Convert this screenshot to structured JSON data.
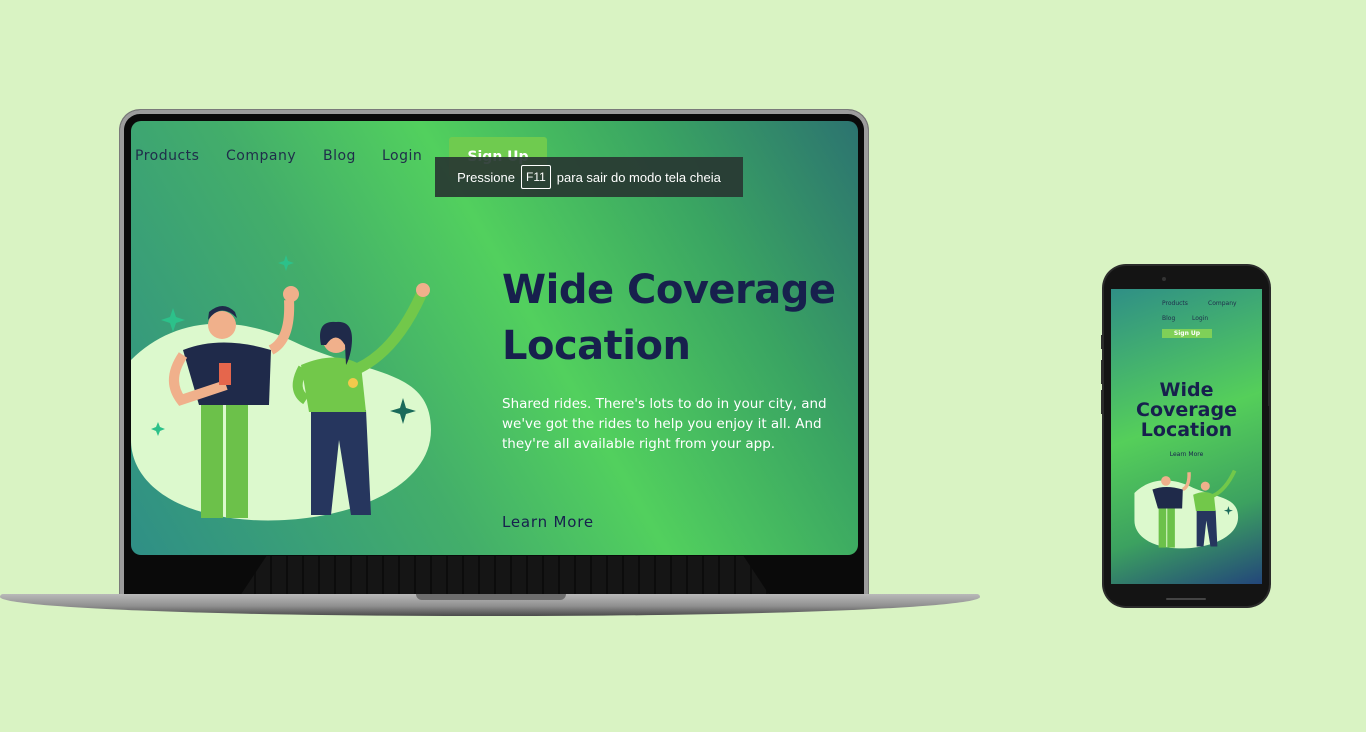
{
  "laptop": {
    "nav": {
      "products": "Products",
      "company": "Company",
      "blog": "Blog",
      "login": "Login",
      "signup": "Sign Up"
    },
    "toast": {
      "prefix": "Pressione",
      "key": "F11",
      "suffix": "para sair do modo tela cheia"
    },
    "hero": {
      "title_line1": "Wide Coverage",
      "title_line2": "Location",
      "text": "Shared rides. There's lots to do in your city, and we've got the rides to help you enjoy it all. And they're all available right from your app.",
      "cta": "Learn More"
    }
  },
  "phone": {
    "nav": {
      "products": "Products",
      "company": "Company",
      "blog": "Blog",
      "login": "Login",
      "signup": "Sign Up"
    },
    "hero": {
      "title_line1": "Wide",
      "title_line2": "Coverage",
      "title_line3": "Location",
      "cta": "Learn More"
    }
  },
  "colors": {
    "background": "#d9f3c3",
    "title": "#17204d",
    "accent": "#6fcb4f",
    "gradient_mid": "#52d05e"
  }
}
